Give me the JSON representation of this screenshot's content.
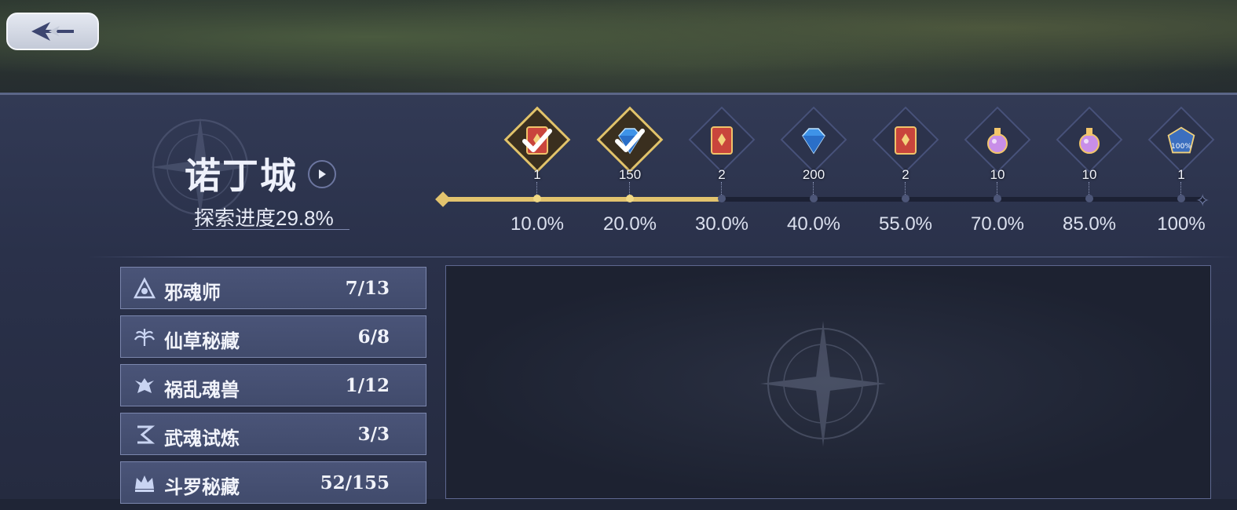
{
  "header": {
    "back_icon": "back-arrow-icon"
  },
  "city": {
    "name": "诺丁城",
    "progress_text": "探索进度29.8%",
    "progress_value": 29.8
  },
  "milestones": [
    {
      "percent": "10.0%",
      "count": "1",
      "icon": "red-book-icon",
      "claimed": true
    },
    {
      "percent": "20.0%",
      "count": "150",
      "icon": "blue-gem-icon",
      "claimed": true
    },
    {
      "percent": "30.0%",
      "count": "2",
      "icon": "red-book-icon",
      "claimed": false
    },
    {
      "percent": "40.0%",
      "count": "200",
      "icon": "blue-gem-icon",
      "claimed": false
    },
    {
      "percent": "55.0%",
      "count": "2",
      "icon": "red-book-icon",
      "claimed": false
    },
    {
      "percent": "70.0%",
      "count": "10",
      "icon": "potion-icon",
      "claimed": false
    },
    {
      "percent": "85.0%",
      "count": "10",
      "icon": "potion-icon",
      "claimed": false
    },
    {
      "percent": "100%",
      "count": "1",
      "icon": "badge-100-icon",
      "claimed": false
    }
  ],
  "categories": [
    {
      "label": "邪魂师",
      "count": "7/13",
      "icon": "evil-soul-icon"
    },
    {
      "label": "仙草秘藏",
      "count": "6/8",
      "icon": "herb-icon"
    },
    {
      "label": "祸乱魂兽",
      "count": "1/12",
      "icon": "beast-icon"
    },
    {
      "label": "武魂试炼",
      "count": "3/3",
      "icon": "trial-icon"
    },
    {
      "label": "斗罗秘藏",
      "count": "52/155",
      "icon": "crown-icon"
    }
  ],
  "colors": {
    "gold": "#e2c36e",
    "panel": "#323a55",
    "item": "#4a5478"
  }
}
